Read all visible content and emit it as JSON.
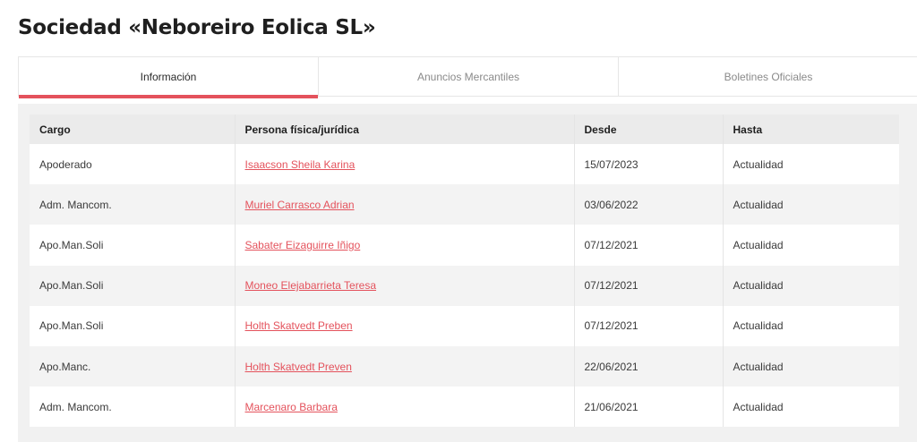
{
  "page": {
    "title": "Sociedad «Neboreiro Eolica SL»"
  },
  "tabs": [
    {
      "label": "Información",
      "active": true
    },
    {
      "label": "Anuncios Mercantiles",
      "active": false
    },
    {
      "label": "Boletines Oficiales",
      "active": false
    }
  ],
  "table": {
    "headers": [
      "Cargo",
      "Persona física/jurídica",
      "Desde",
      "Hasta"
    ],
    "rows": [
      {
        "cargo": "Apoderado",
        "persona": "Isaacson Sheila Karina",
        "desde": "15/07/2023",
        "hasta": "Actualidad"
      },
      {
        "cargo": "Adm. Mancom.",
        "persona": "Muriel Carrasco Adrian",
        "desde": "03/06/2022",
        "hasta": "Actualidad"
      },
      {
        "cargo": "Apo.Man.Soli",
        "persona": "Sabater Eizaguirre Iñigo",
        "desde": "07/12/2021",
        "hasta": "Actualidad"
      },
      {
        "cargo": "Apo.Man.Soli",
        "persona": "Moneo Elejabarrieta Teresa",
        "desde": "07/12/2021",
        "hasta": "Actualidad"
      },
      {
        "cargo": "Apo.Man.Soli",
        "persona": "Holth Skatvedt Preben",
        "desde": "07/12/2021",
        "hasta": "Actualidad"
      },
      {
        "cargo": "Apo.Manc.",
        "persona": "Holth Skatvedt Preven",
        "desde": "22/06/2021",
        "hasta": "Actualidad"
      },
      {
        "cargo": "Adm. Mancom.",
        "persona": "Marcenaro Barbara",
        "desde": "21/06/2021",
        "hasta": "Actualidad"
      }
    ]
  },
  "colors": {
    "accent": "#e4525c",
    "header_bg": "#ebebeb",
    "panel_bg": "#f1f1f1"
  }
}
